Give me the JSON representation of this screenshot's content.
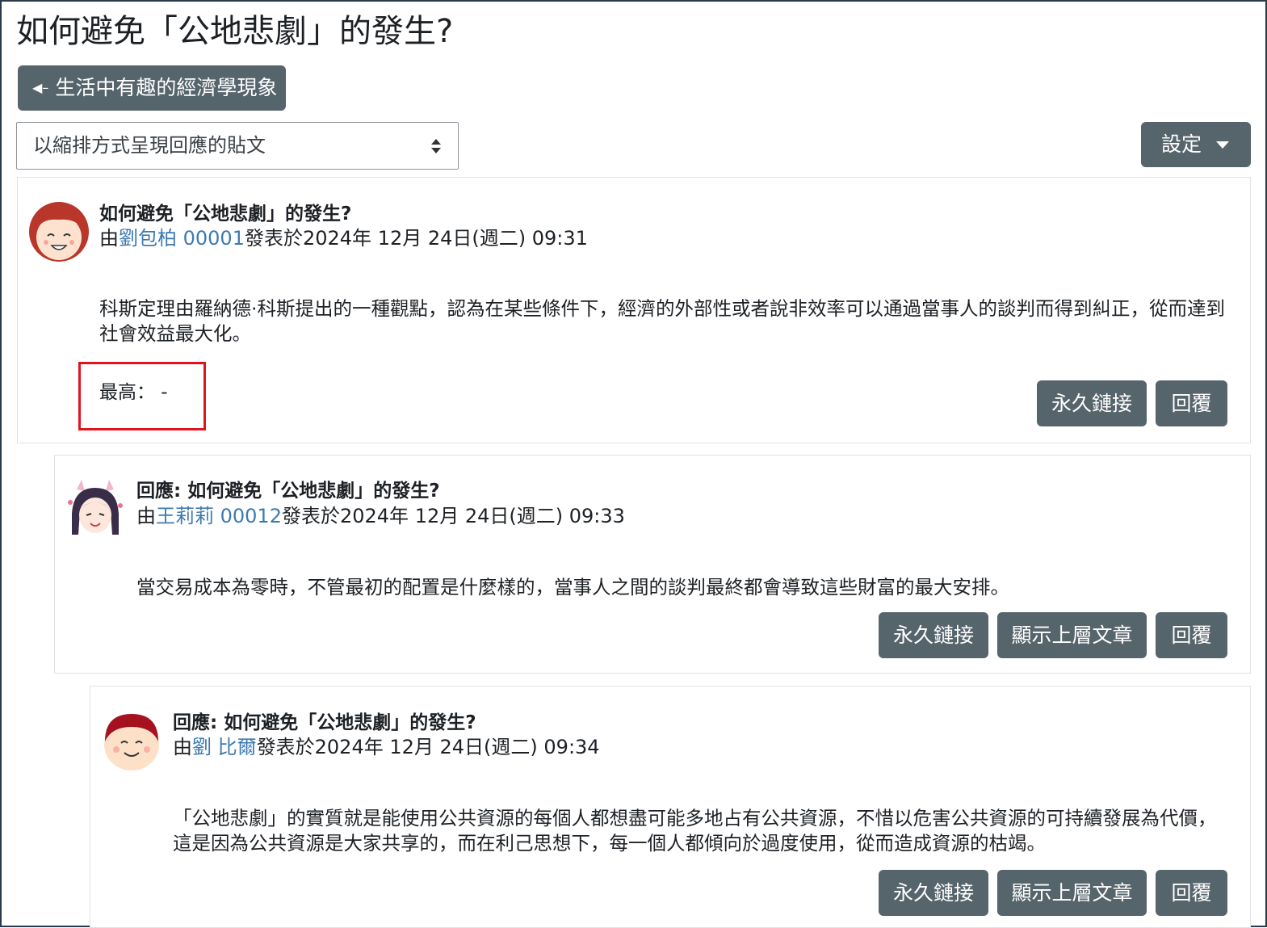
{
  "page": {
    "title": "如何避免「公地悲劇」的發生?",
    "back_label": "生活中有趣的經濟學現象",
    "display_mode": "以縮排方式呈現回應的貼文",
    "settings_label": "設定"
  },
  "posts": [
    {
      "subject": "如何避免「公地悲劇」的發生?",
      "by": "由",
      "author": "劉包柏 00001",
      "posted": "發表於2024年 12月 24日(週二) 09:31",
      "body": "科斯定理由羅納德·科斯提出的一種觀點，認為在某些條件下，經濟的外部性或者說非效率可以通過當事人的談判而得到糾正，從而達到社會效益最大化。",
      "rating": "最高：  -",
      "permalink_label": "永久鏈接",
      "reply_label": "回覆"
    },
    {
      "subject": "回應: 如何避免「公地悲劇」的發生?",
      "by": "由",
      "author": "王莉莉 00012",
      "posted": "發表於2024年 12月 24日(週二) 09:33",
      "body": "當交易成本為零時，不管最初的配置是什麼樣的，當事人之間的談判最終都會導致這些財富的最大安排。",
      "permalink_label": "永久鏈接",
      "parent_label": "顯示上層文章",
      "reply_label": "回覆"
    },
    {
      "subject": "回應: 如何避免「公地悲劇」的發生?",
      "by": "由",
      "author": "劉 比爾",
      "posted": "發表於2024年 12月 24日(週二) 09:34",
      "body": "「公地悲劇」的實質就是能使用公共資源的每個人都想盡可能多地占有公共資源，不惜以危害公共資源的可持續發展為代價，這是因為公共資源是大家共享的，而在利己思想下，每一個人都傾向於過度使用，從而造成資源的枯竭。",
      "permalink_label": "永久鏈接",
      "parent_label": "顯示上層文章",
      "reply_label": "回覆"
    }
  ],
  "icons": {
    "back": "left-arrow-icon",
    "select": "sort-caret-icon",
    "settings": "caret-down-icon"
  },
  "colors": {
    "button": "#56646c",
    "link": "#3e7ab0",
    "highlight": "#e0141e",
    "border": "#dee2e6"
  }
}
